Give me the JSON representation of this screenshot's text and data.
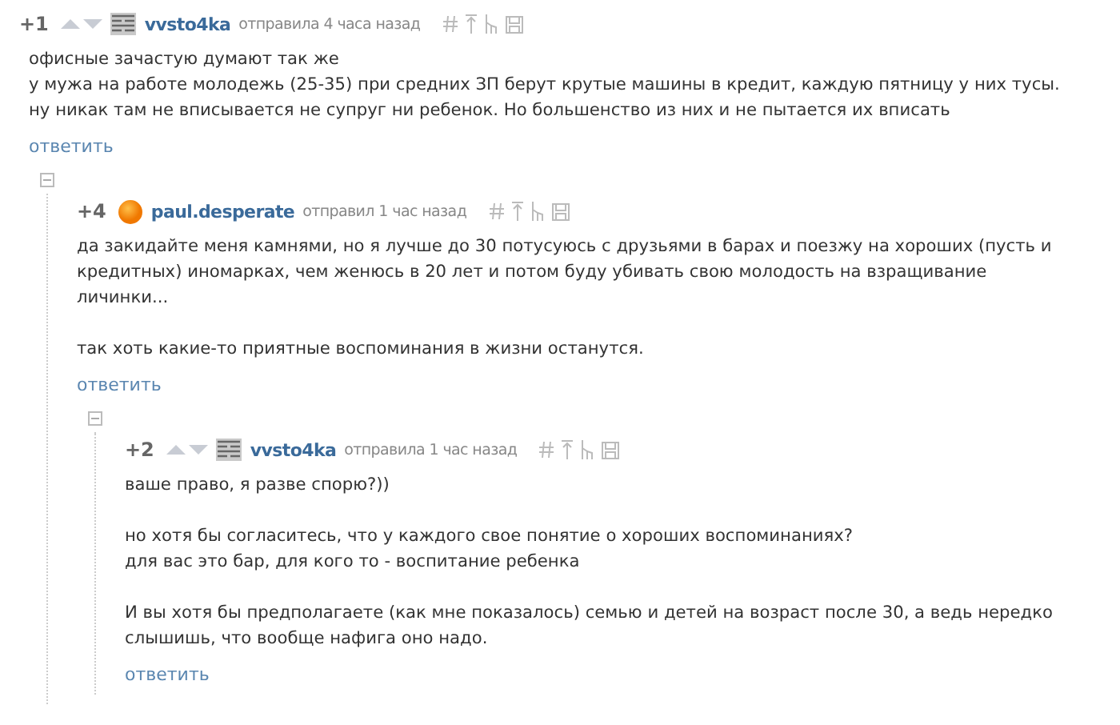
{
  "comments": [
    {
      "score": "+1",
      "votes_shown": true,
      "avatar": {
        "kind": "pattern"
      },
      "author": "vvsto4ka",
      "action": "отправила",
      "time": "4 часа назад",
      "paragraphs": [
        [
          "офисные зачастую думают так же",
          "у мужа на работе молодежь (25-35) при средних ЗП берут крутые машины в кредит, каждую пятницу у них тусы. ну никак там не вписывается не супруг ни ребенок. Но большенство из них и не пытается их вписать"
        ]
      ],
      "reply": "ответить",
      "children": [
        {
          "score": "+4",
          "votes_shown": false,
          "avatar": {
            "kind": "circle"
          },
          "author": "paul.desperate",
          "action": "отправил",
          "time": "1 час назад",
          "expanded": true,
          "paragraphs": [
            [
              "да закидайте меня камнями, но я лучше до 30 потусуюсь с друзьями в барах и поезжу на хороших (пусть и кредитных) иномарках, чем женюсь в 20 лет и потом буду убивать свою молодость на взращивание личинки..."
            ],
            [
              "так хоть какие-то приятные воспоминания в жизни останутся."
            ]
          ],
          "reply": "ответить",
          "children": [
            {
              "score": "+2",
              "votes_shown": true,
              "avatar": {
                "kind": "pattern"
              },
              "author": "vvsto4ka",
              "action": "отправила",
              "time": "1 час назад",
              "expanded": true,
              "paragraphs": [
                [
                  "ваше право, я разве спорю?))"
                ],
                [
                  "но хотя бы согласитесь, что у каждого свое понятие о хороших воспоминаниях?",
                  "для вас это бар, для кого то - воспитание ребенка"
                ],
                [
                  "И вы хотя бы предполагаете (как мне показалось) семью и детей на возраст после 30, а ведь нередко слышишь, что вообще нафига оно надо."
                ]
              ],
              "reply": "ответить"
            }
          ]
        }
      ]
    }
  ]
}
